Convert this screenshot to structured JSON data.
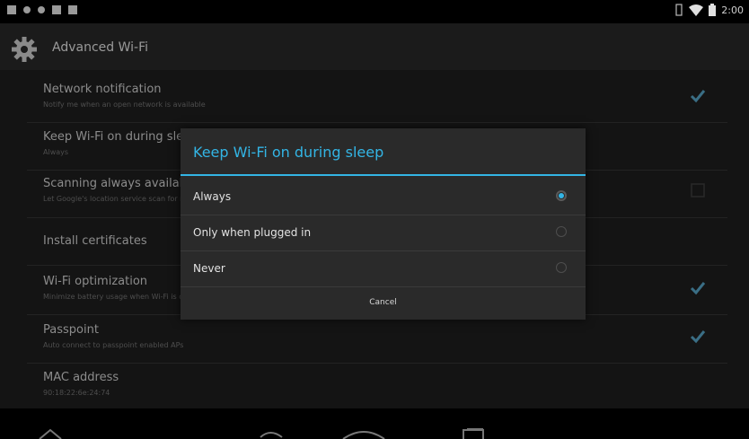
{
  "status_bar": {
    "time": "2:00"
  },
  "action_bar": {
    "title": "Advanced Wi-Fi",
    "icon": "gear-icon"
  },
  "settings": [
    {
      "title": "Network notification",
      "summary": "Notify me when an open network is available",
      "checked": true
    },
    {
      "title": "Keep Wi-Fi on during sleep",
      "summary": "Always"
    },
    {
      "title": "Scanning always available",
      "summary": "Let Google's location service scan for networks",
      "checked": false
    },
    {
      "title": "Install certificates",
      "summary": ""
    },
    {
      "title": "Wi-Fi optimization",
      "summary": "Minimize battery usage when Wi-Fi is on",
      "checked": true
    },
    {
      "title": "Passpoint",
      "summary": "Auto connect to passpoint enabled APs",
      "checked": true
    },
    {
      "title": "MAC address",
      "summary": "90:18:22:6e:24:74"
    }
  ],
  "dialog": {
    "title": "Keep Wi-Fi on during sleep",
    "options": [
      {
        "label": "Always",
        "selected": true
      },
      {
        "label": "Only when plugged in",
        "selected": false
      },
      {
        "label": "Never",
        "selected": false
      }
    ],
    "cancel_label": "Cancel"
  },
  "colors": {
    "accent": "#33b5e5",
    "background": "#141414",
    "dialog": "#2a2a2a"
  }
}
